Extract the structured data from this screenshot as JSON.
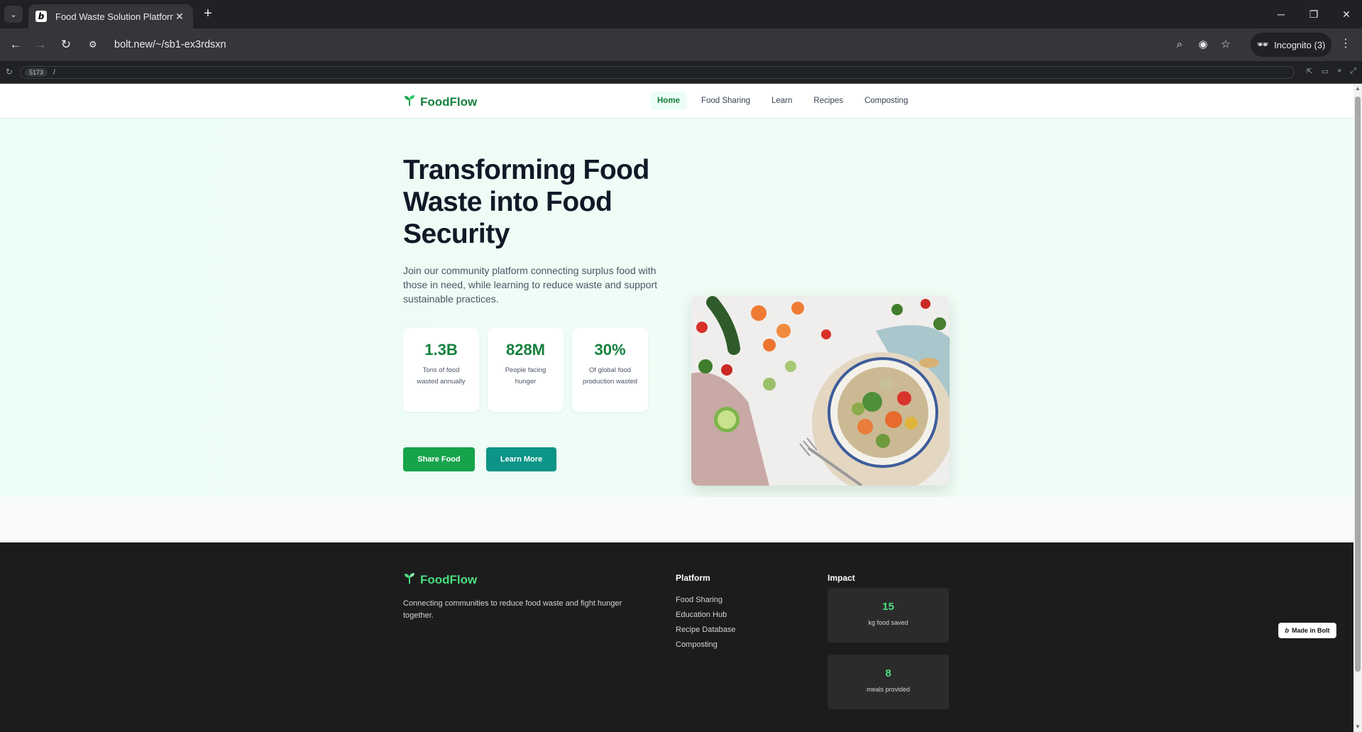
{
  "browser": {
    "tab_title": "Food Waste Solution Platform",
    "favicon_letter": "b",
    "url": "bolt.new/~/sb1-ex3rdsxn",
    "incognito_label": "Incognito (3)",
    "dev_port": "5173",
    "dev_path": "/"
  },
  "nav": {
    "brand": "FoodFlow",
    "links": [
      "Home",
      "Food Sharing",
      "Learn",
      "Recipes",
      "Composting"
    ],
    "active": "Home"
  },
  "hero": {
    "title": "Transforming Food Waste into Food Security",
    "description": "Join our community platform connecting surplus food with those in need, while learning to reduce waste and support sustainable practices.",
    "stats": [
      {
        "value": "1.3B",
        "label": "Tons of food wasted annually"
      },
      {
        "value": "828M",
        "label": "People facing hunger"
      },
      {
        "value": "30%",
        "label": "Of global food production wasted"
      }
    ],
    "share_button": "Share Food",
    "learn_button": "Learn More"
  },
  "footer": {
    "brand": "FoodFlow",
    "description": "Connecting communities to reduce food waste and fight hunger together.",
    "platform_title": "Platform",
    "platform_links": [
      "Food Sharing",
      "Education Hub",
      "Recipe Database",
      "Composting"
    ],
    "impact_title": "Impact",
    "impact": [
      {
        "value": "15",
        "label": "kg food saved"
      },
      {
        "value": "8",
        "label": "meals provided"
      }
    ]
  },
  "badge": "Made in Bolt",
  "colors": {
    "brand_green": "#15803d",
    "button_green": "#16a34a",
    "button_teal": "#0d9488",
    "footer_accent": "#4ade80"
  }
}
